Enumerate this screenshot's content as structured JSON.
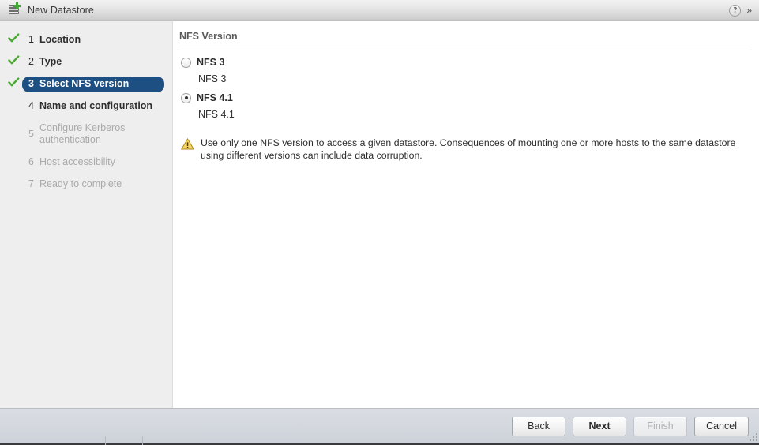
{
  "window": {
    "title": "New Datastore",
    "icon": "new-datastore-icon",
    "help_label": "?",
    "expand_label": "»"
  },
  "sidebar": {
    "steps": [
      {
        "num": "1",
        "label": "Location",
        "state": "done"
      },
      {
        "num": "2",
        "label": "Type",
        "state": "done"
      },
      {
        "num": "3",
        "label": "Select NFS version",
        "state": "active"
      },
      {
        "num": "4",
        "label": "Name and configuration",
        "state": "next"
      },
      {
        "num": "5",
        "label": "Configure Kerberos authentication",
        "state": "disabled"
      },
      {
        "num": "6",
        "label": "Host accessibility",
        "state": "disabled"
      },
      {
        "num": "7",
        "label": "Ready to complete",
        "state": "disabled"
      }
    ]
  },
  "main": {
    "panel_title": "NFS Version",
    "options": [
      {
        "label": "NFS 3",
        "description": "NFS 3",
        "selected": false
      },
      {
        "label": "NFS 4.1",
        "description": "NFS 4.1",
        "selected": true
      }
    ],
    "warning": {
      "icon": "warning-triangle-icon",
      "text": "Use only one NFS version to access a given datastore. Consequences of mounting one or more hosts to the same datastore using different versions can include data corruption."
    }
  },
  "footer": {
    "buttons": [
      {
        "label": "Back",
        "style": "normal",
        "enabled": true
      },
      {
        "label": "Next",
        "style": "primary",
        "enabled": true
      },
      {
        "label": "Finish",
        "style": "disabled",
        "enabled": false
      },
      {
        "label": "Cancel",
        "style": "normal",
        "enabled": true
      }
    ]
  },
  "colors": {
    "accent_selected": "#1d4f82",
    "check_green": "#4aa832",
    "warning_amber": "#f2c31e",
    "sidebar_bg": "#eeeeee",
    "footer_bg": "#d3d7de"
  }
}
